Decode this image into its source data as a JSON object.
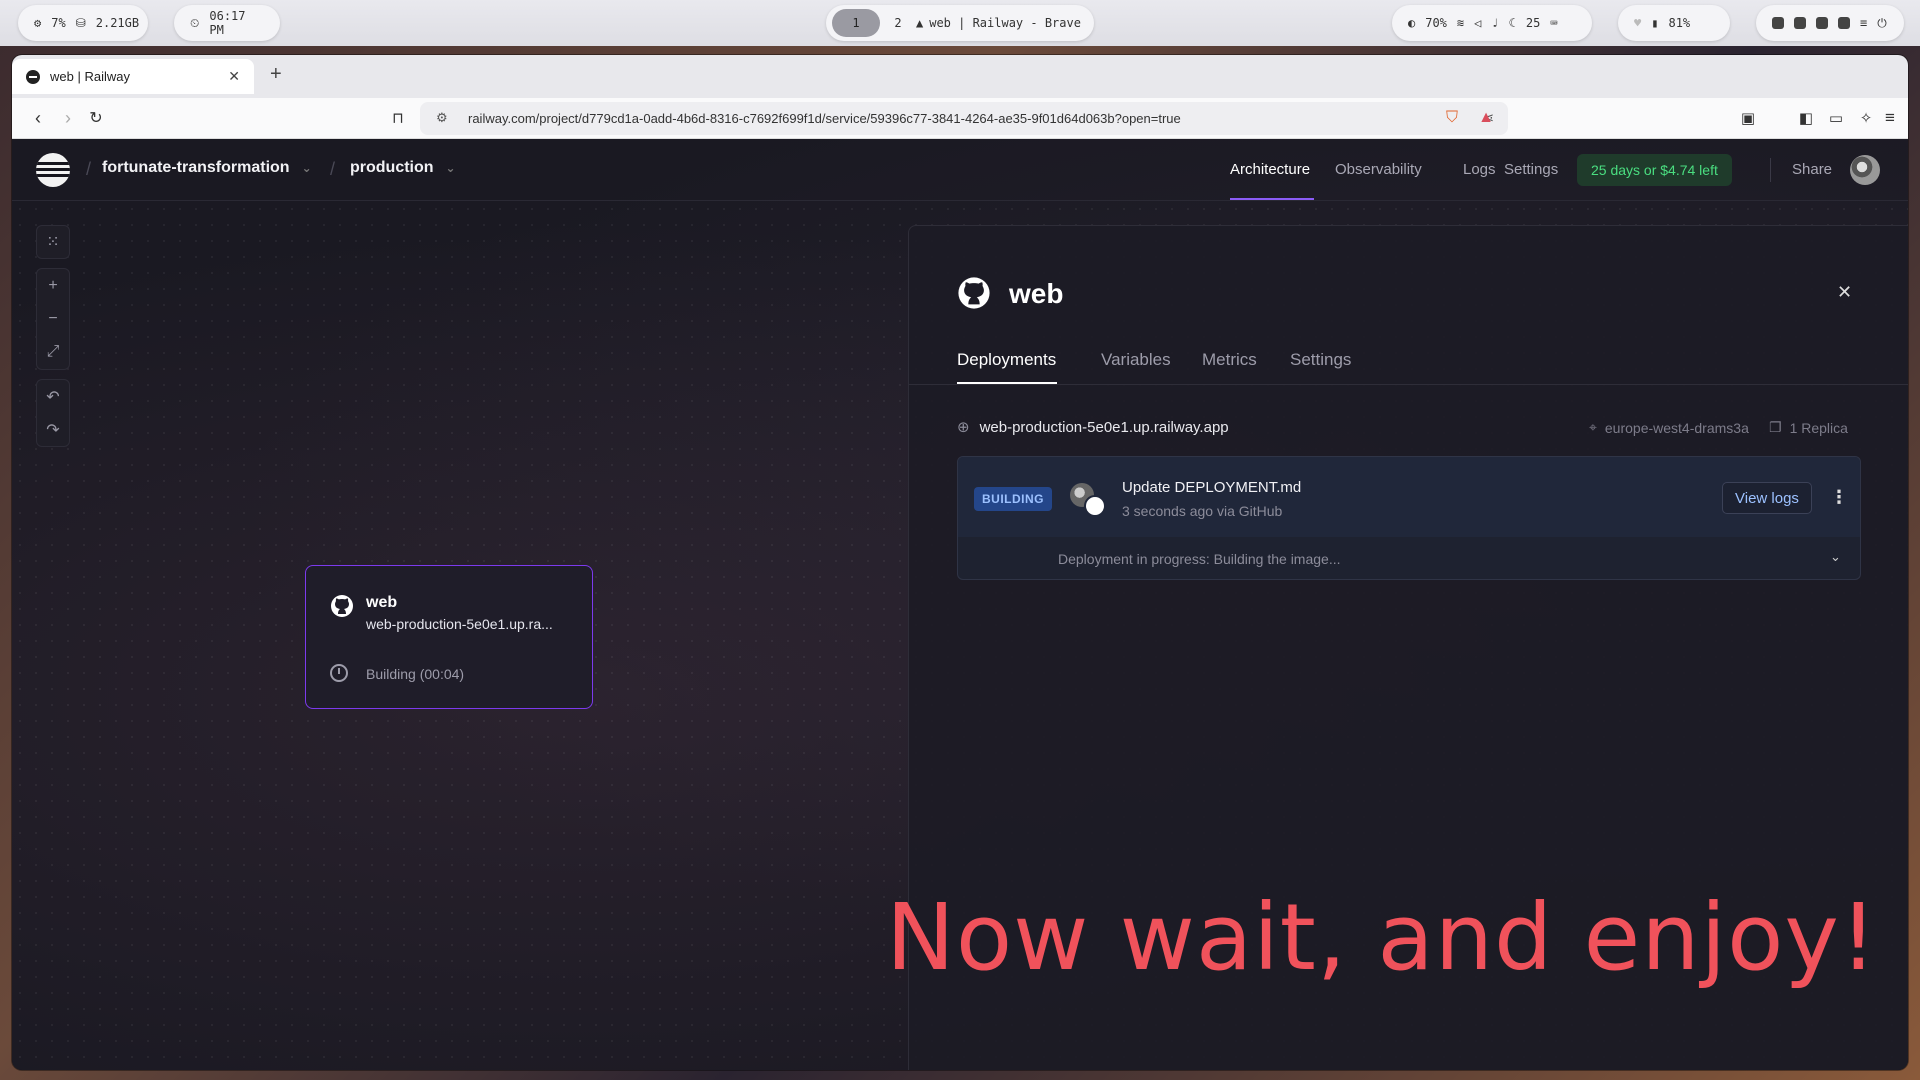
{
  "os_bar": {
    "cpu": "7%",
    "memory": "2.21GB",
    "clock": "06:17 PM",
    "workspaces": [
      "1",
      "2"
    ],
    "window_title": "web | Railway - Brave",
    "brightness": "70%",
    "temperature": "25",
    "battery": "81%"
  },
  "browser": {
    "tab_title": "web | Railway",
    "url": "railway.com/project/d779cd1a-0add-4b6d-8316-c7692f699f1d/service/59396c77-3841-4264-ae35-9f01d64d063b?open=true"
  },
  "header": {
    "project": "fortunate-transformation",
    "environment": "production",
    "nav": [
      "Architecture",
      "Observability",
      "Logs",
      "Settings"
    ],
    "trial": "25 days or $4.74 left",
    "share": "Share"
  },
  "node": {
    "title": "web",
    "url": "web-production-5e0e1.up.ra...",
    "status": "Building (00:04)"
  },
  "panel": {
    "title": "web",
    "tabs": [
      "Deployments",
      "Variables",
      "Metrics",
      "Settings"
    ],
    "domain": "web-production-5e0e1.up.railway.app",
    "region": "europe-west4-drams3a",
    "replicas": "1 Replica",
    "deployment": {
      "badge": "BUILDING",
      "commit": "Update DEPLOYMENT.md",
      "meta": "3 seconds ago via GitHub",
      "view_logs": "View logs",
      "progress_label": "Deployment in progress:",
      "progress_status": "Building the image..."
    }
  },
  "caption": "Now wait, and enjoy!",
  "colors": {
    "accent": "#8b5cf6",
    "trial_green": "#4ade80",
    "building_badge": "#24468a",
    "caption_red": "#f0525b"
  }
}
